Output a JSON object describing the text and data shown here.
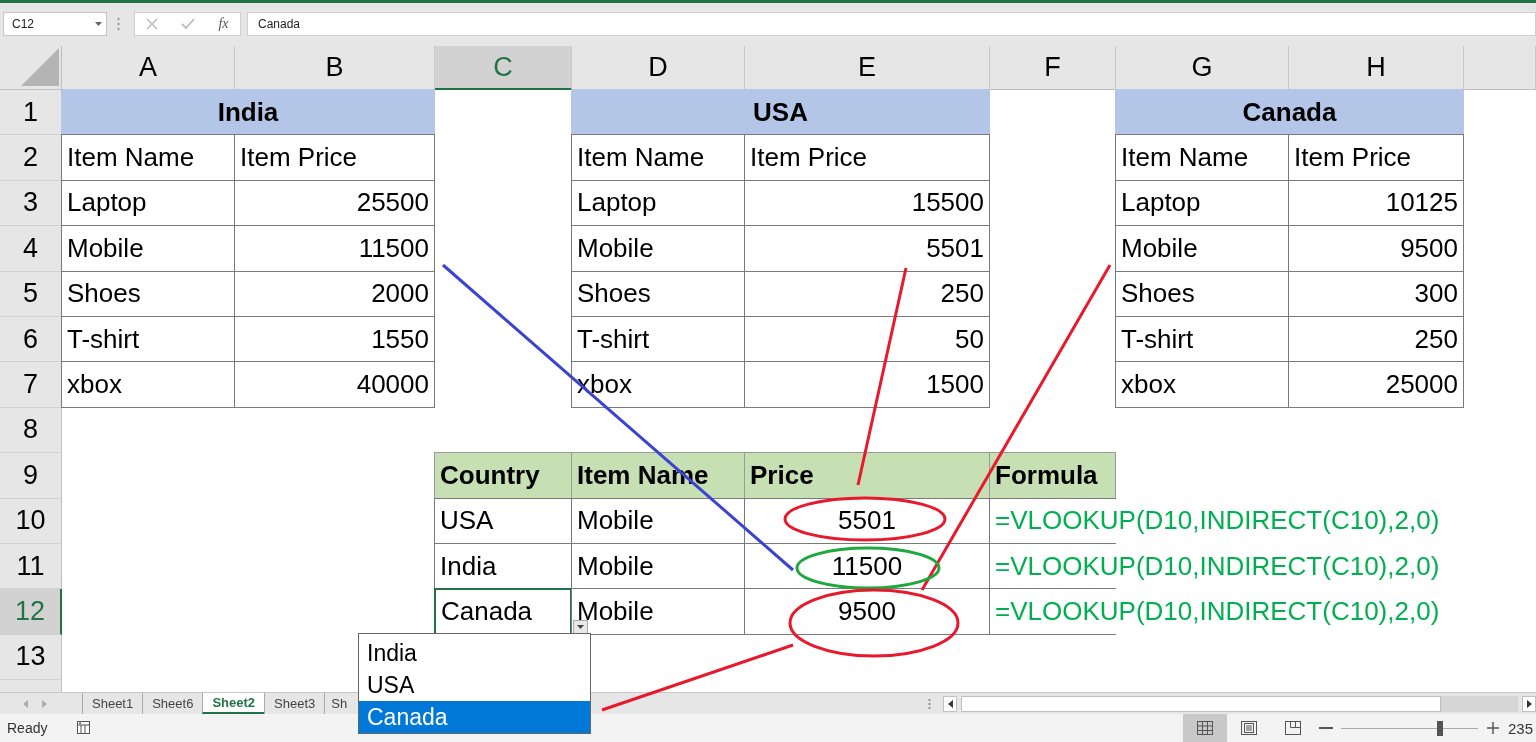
{
  "formula_bar": {
    "name_box": "C12",
    "fx_label": "fx",
    "formula": "Canada"
  },
  "columns": [
    {
      "label": "A",
      "selected": false
    },
    {
      "label": "B",
      "selected": false
    },
    {
      "label": "C",
      "selected": true
    },
    {
      "label": "D",
      "selected": false
    },
    {
      "label": "E",
      "selected": false
    },
    {
      "label": "F",
      "selected": false
    },
    {
      "label": "G",
      "selected": false
    },
    {
      "label": "H",
      "selected": false
    }
  ],
  "rows": [
    {
      "label": "1",
      "selected": false,
      "cells": [
        {
          "text": "India",
          "kind": "title"
        },
        {
          "kind": "merged"
        },
        {
          "kind": "empty"
        },
        {
          "text": "USA",
          "kind": "title"
        },
        {
          "kind": "merged"
        },
        {
          "kind": "empty"
        },
        {
          "text": "Canada",
          "kind": "title"
        },
        {
          "kind": "merged"
        }
      ]
    },
    {
      "label": "2",
      "selected": false,
      "cells": [
        {
          "text": "Item Name",
          "kind": "text"
        },
        {
          "text": "Item Price",
          "kind": "text"
        },
        {
          "kind": "empty"
        },
        {
          "text": "Item Name",
          "kind": "text"
        },
        {
          "text": "Item Price",
          "kind": "text"
        },
        {
          "kind": "empty"
        },
        {
          "text": "Item Name",
          "kind": "text"
        },
        {
          "text": "Item Price",
          "kind": "text"
        }
      ]
    },
    {
      "label": "3",
      "selected": false,
      "cells": [
        {
          "text": "Laptop",
          "kind": "text"
        },
        {
          "text": "25500",
          "kind": "number"
        },
        {
          "kind": "empty"
        },
        {
          "text": "Laptop",
          "kind": "text"
        },
        {
          "text": "15500",
          "kind": "number"
        },
        {
          "kind": "empty"
        },
        {
          "text": "Laptop",
          "kind": "text"
        },
        {
          "text": "10125",
          "kind": "number"
        }
      ]
    },
    {
      "label": "4",
      "selected": false,
      "cells": [
        {
          "text": "Mobile",
          "kind": "text"
        },
        {
          "text": "11500",
          "kind": "number"
        },
        {
          "kind": "empty"
        },
        {
          "text": "Mobile",
          "kind": "text"
        },
        {
          "text": "5501",
          "kind": "number"
        },
        {
          "kind": "empty"
        },
        {
          "text": "Mobile",
          "kind": "text"
        },
        {
          "text": "9500",
          "kind": "number"
        }
      ]
    },
    {
      "label": "5",
      "selected": false,
      "cells": [
        {
          "text": "Shoes",
          "kind": "text"
        },
        {
          "text": "2000",
          "kind": "number"
        },
        {
          "kind": "empty"
        },
        {
          "text": "Shoes",
          "kind": "text"
        },
        {
          "text": "250",
          "kind": "number"
        },
        {
          "kind": "empty"
        },
        {
          "text": "Shoes",
          "kind": "text"
        },
        {
          "text": "300",
          "kind": "number"
        }
      ]
    },
    {
      "label": "6",
      "selected": false,
      "cells": [
        {
          "text": "T-shirt",
          "kind": "text"
        },
        {
          "text": "1550",
          "kind": "number"
        },
        {
          "kind": "empty"
        },
        {
          "text": "T-shirt",
          "kind": "text"
        },
        {
          "text": "50",
          "kind": "number"
        },
        {
          "kind": "empty"
        },
        {
          "text": "T-shirt",
          "kind": "text"
        },
        {
          "text": "250",
          "kind": "number"
        }
      ]
    },
    {
      "label": "7",
      "selected": false,
      "cells": [
        {
          "text": "xbox",
          "kind": "text"
        },
        {
          "text": "40000",
          "kind": "number"
        },
        {
          "kind": "empty"
        },
        {
          "text": "xbox",
          "kind": "text"
        },
        {
          "text": "1500",
          "kind": "number"
        },
        {
          "kind": "empty"
        },
        {
          "text": "xbox",
          "kind": "text"
        },
        {
          "text": "25000",
          "kind": "number"
        }
      ]
    },
    {
      "label": "8",
      "selected": false,
      "cells": []
    },
    {
      "label": "9",
      "selected": false,
      "cells": [
        {
          "kind": "empty"
        },
        {
          "kind": "empty"
        },
        {
          "text": "Country",
          "kind": "header"
        },
        {
          "text": "Item Name",
          "kind": "header"
        },
        {
          "text": "Price",
          "kind": "header"
        },
        {
          "text": "Formula",
          "kind": "header"
        }
      ]
    },
    {
      "label": "10",
      "selected": false,
      "cells": [
        {
          "kind": "empty"
        },
        {
          "kind": "empty"
        },
        {
          "text": "USA",
          "kind": "text"
        },
        {
          "text": "Mobile",
          "kind": "text"
        },
        {
          "text": "5501",
          "kind": "center"
        },
        {
          "text": "=VLOOKUP(D10,INDIRECT(C10),2,0)",
          "kind": "formula"
        }
      ]
    },
    {
      "label": "11",
      "selected": false,
      "cells": [
        {
          "kind": "empty"
        },
        {
          "kind": "empty"
        },
        {
          "text": "India",
          "kind": "text"
        },
        {
          "text": "Mobile",
          "kind": "text"
        },
        {
          "text": "11500",
          "kind": "center"
        },
        {
          "text": "=VLOOKUP(D10,INDIRECT(C10),2,0)",
          "kind": "formula"
        }
      ]
    },
    {
      "label": "12",
      "selected": true,
      "cells": [
        {
          "kind": "empty"
        },
        {
          "kind": "empty"
        },
        {
          "text": "Canada",
          "kind": "text"
        },
        {
          "text": "Mobile",
          "kind": "text"
        },
        {
          "text": "9500",
          "kind": "center"
        },
        {
          "text": "=VLOOKUP(D10,INDIRECT(C10),2,0)",
          "kind": "formula"
        }
      ]
    },
    {
      "label": "13",
      "selected": false,
      "cells": []
    }
  ],
  "dropdown": {
    "options": [
      {
        "label": "India",
        "selected": false
      },
      {
        "label": "USA",
        "selected": false
      },
      {
        "label": "Canada",
        "selected": true
      }
    ]
  },
  "sheet_tabs": [
    {
      "label": "Sheet1",
      "selected": false
    },
    {
      "label": "Sheet6",
      "selected": false
    },
    {
      "label": "Sheet2",
      "selected": true
    },
    {
      "label": "Sheet3",
      "selected": false
    },
    {
      "label": "Sh",
      "selected": false
    }
  ],
  "status_bar": {
    "mode": "Ready",
    "views": [
      {
        "kind": "normal",
        "selected": true
      },
      {
        "kind": "page-layout",
        "selected": false
      },
      {
        "kind": "page-break",
        "selected": false
      }
    ],
    "zoom_slider": {
      "level": 0.72
    },
    "zoom": "235"
  }
}
